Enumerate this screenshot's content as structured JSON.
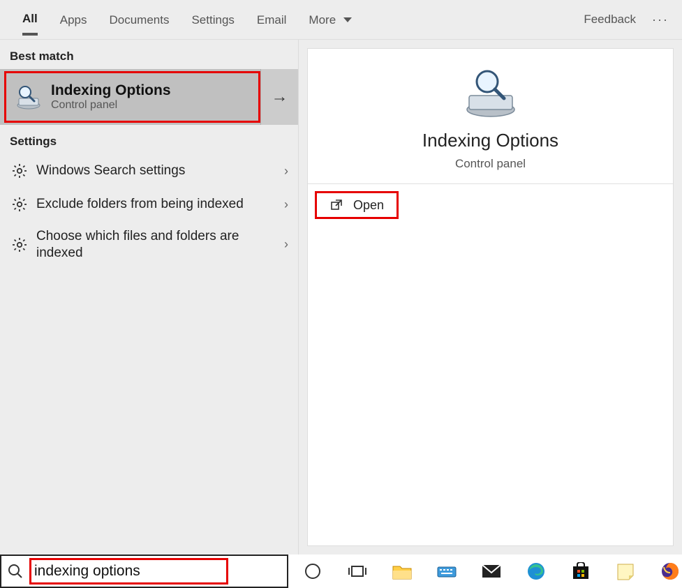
{
  "tabs": [
    "All",
    "Apps",
    "Documents",
    "Settings",
    "Email",
    "More"
  ],
  "active_tab_index": 0,
  "feedback_label": "Feedback",
  "section_best_match": "Best match",
  "best_match": {
    "title": "Indexing Options",
    "subtitle": "Control panel"
  },
  "section_settings": "Settings",
  "settings_items": [
    {
      "label": "Windows Search settings"
    },
    {
      "label": "Exclude folders from being indexed"
    },
    {
      "label": "Choose which files and folders are indexed"
    }
  ],
  "detail": {
    "title": "Indexing Options",
    "subtitle": "Control panel",
    "open_label": "Open"
  },
  "search_value": "indexing options"
}
